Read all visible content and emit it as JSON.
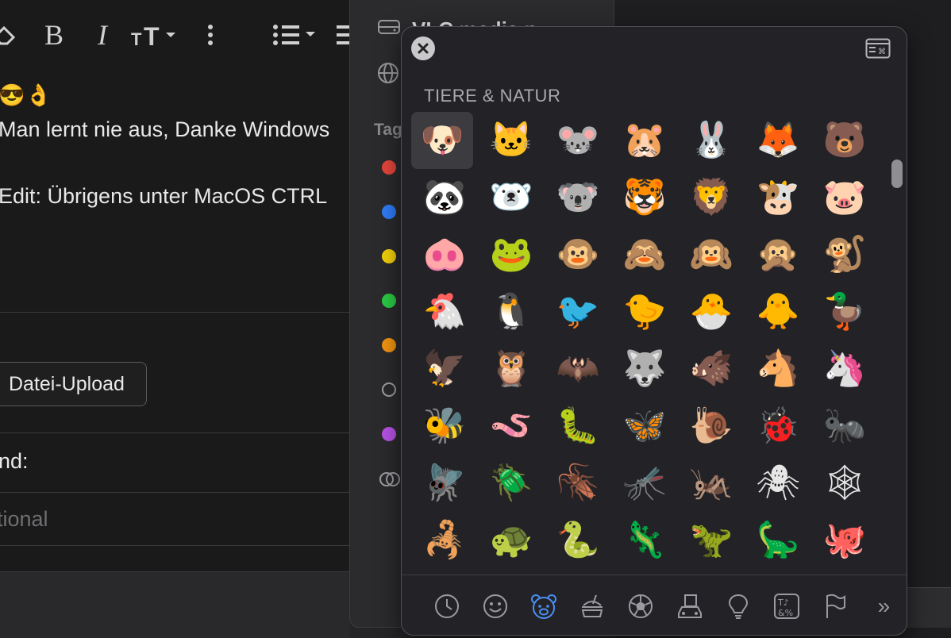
{
  "editor": {
    "post_lines": [
      "😎👌",
      "Man lernt nie aus, Danke Windows",
      "Edit: Übrigens unter MacOS CTRL"
    ],
    "upload_button": "Datei-Upload",
    "reason_label": "nd:",
    "reason_placeholder": "tional"
  },
  "finder": {
    "drive_label": "VLC media p",
    "tags_label": "Tag",
    "tag_colors": [
      "#e5453b",
      "#2f7cf6",
      "#f2d00a",
      "#2bca45",
      "#f09410",
      "outline",
      "#b753e6",
      "multi"
    ]
  },
  "picker": {
    "section_title": "TIERE & NATUR",
    "emojis": [
      "🐶",
      "🐱",
      "🐭",
      "🐹",
      "🐰",
      "🦊",
      "🐻",
      "🐼",
      "🐻‍❄️",
      "🐨",
      "🐯",
      "🦁",
      "🐮",
      "🐷",
      "🐽",
      "🐸",
      "🐵",
      "🙈",
      "🙉",
      "🙊",
      "🐒",
      "🐔",
      "🐧",
      "🐦",
      "🐤",
      "🐣",
      "🐥",
      "🦆",
      "🦅",
      "🦉",
      "🦇",
      "🐺",
      "🐗",
      "🐴",
      "🦄",
      "🐝",
      "🪱",
      "🐛",
      "🦋",
      "🐌",
      "🐞",
      "🐜",
      "🪰",
      "🪲",
      "🪳",
      "🦟",
      "🦗",
      "🕷",
      "🕸",
      "🦂",
      "🐢",
      "🐍",
      "🦎",
      "🦖",
      "🦕",
      "🐙"
    ],
    "selected_index": 0,
    "categories": [
      "clock-icon",
      "smiley-icon",
      "bear-icon",
      "food-icon",
      "ball-icon",
      "building-icon",
      "bulb-icon",
      "symbols-icon",
      "flag-icon"
    ],
    "active_category": "bear-icon",
    "more_label": "»"
  }
}
